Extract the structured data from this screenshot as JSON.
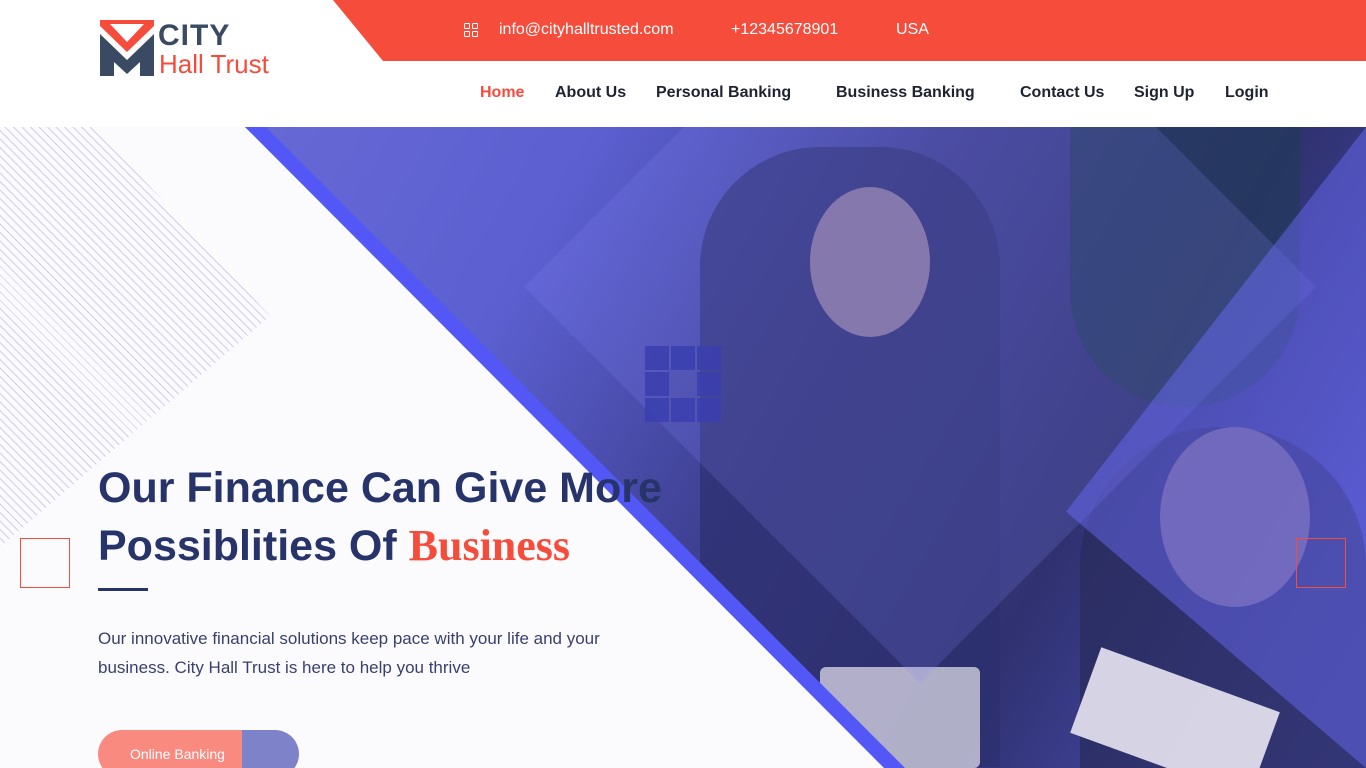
{
  "brand": {
    "line1": "CITY",
    "line2": "Hall Trust"
  },
  "topbar": {
    "email": "info@cityhalltrusted.com",
    "phone": "+12345678901",
    "country": "USA"
  },
  "nav": {
    "home": "Home",
    "about": "About Us",
    "personal": "Personal Banking",
    "business": "Business Banking",
    "contact": "Contact Us",
    "signup": "Sign Up",
    "login": "Login"
  },
  "hero": {
    "headline_line1": "Our Finance Can Give More",
    "headline_line2": "Possiblities Of ",
    "headline_accent": "Business",
    "subtext": "Our innovative financial solutions keep pace with your life and your business. City Hall Trust is here to help you thrive",
    "cta": "Online Banking"
  },
  "colors": {
    "accent": "#f64c3c",
    "navy": "#27346a",
    "stripe": "#5257f5"
  },
  "icons": [
    "grid-icon",
    "logo-icon",
    "squares-icon"
  ]
}
